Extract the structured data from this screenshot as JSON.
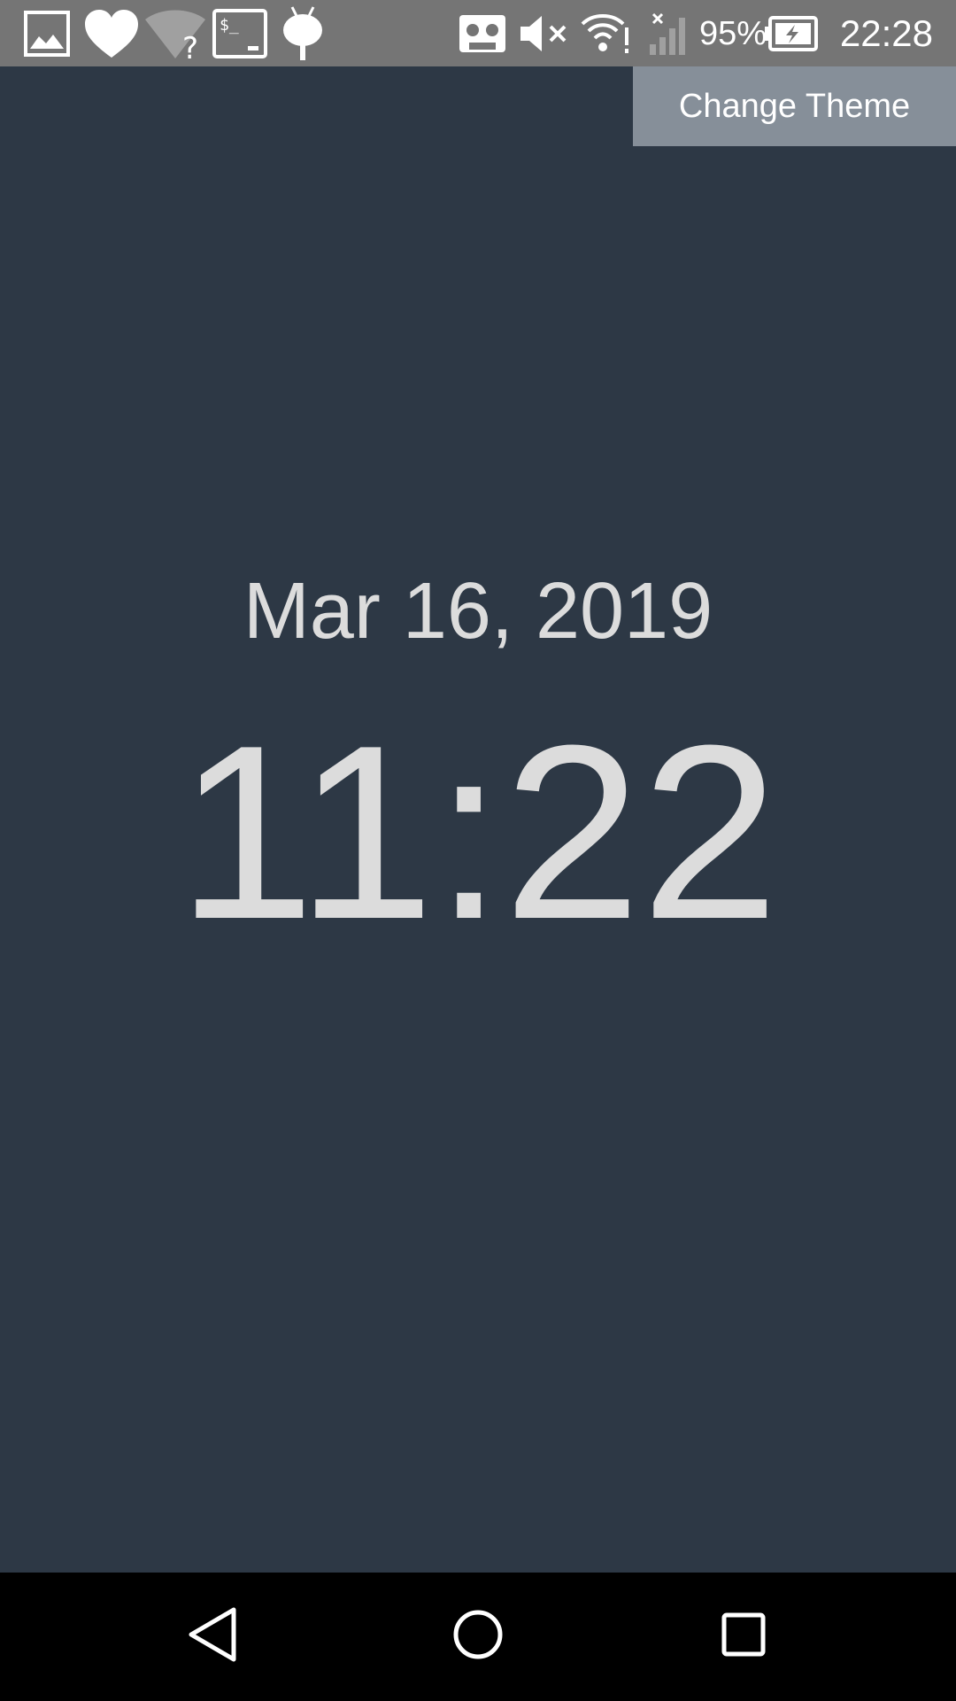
{
  "status_bar": {
    "battery_percent": "95%",
    "clock": "22:28",
    "icons": [
      "gallery-icon",
      "heart-icon",
      "wifi-unknown-icon",
      "terminal-icon",
      "android-icon",
      "voicemail-icon",
      "mute-icon",
      "wifi-alert-icon",
      "signal-no-sim-icon",
      "battery-charging-icon"
    ]
  },
  "header": {
    "change_theme_label": "Change Theme"
  },
  "clock": {
    "date": "Mar 16, 2019",
    "time": "11:22"
  },
  "nav_bar": {
    "icons": [
      "back-icon",
      "home-icon",
      "recents-icon"
    ]
  },
  "colors": {
    "background": "#2d3845",
    "status_bar": "#757575",
    "button": "#868f99",
    "text": "#dcdcdc"
  }
}
